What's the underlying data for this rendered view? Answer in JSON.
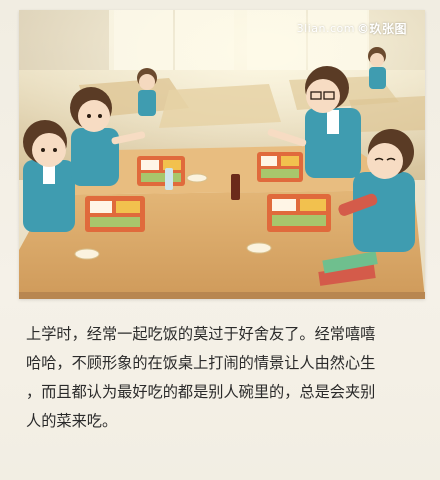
{
  "watermark": {
    "site": "3lian.com",
    "brand": "©玖张图"
  },
  "caption": {
    "lines": [
      "上学时，经常一起吃饭的莫过于好舍友了。经常嘻嘻",
      "哈哈，不顾形象的在饭桌上打闹的情景让人由然心生",
      "，而且都认为最好吃的都是别人碗里的，总是会夹别",
      "人的菜来吃。"
    ]
  },
  "colors": {
    "background": "#f3efe4",
    "table": "#d9a867",
    "uniform": "#3f9cb0",
    "text": "#2a2a2a"
  }
}
